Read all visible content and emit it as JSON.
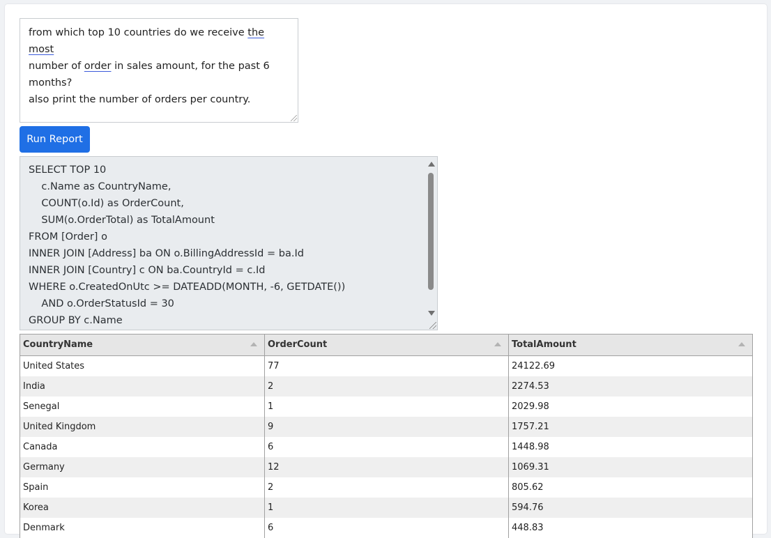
{
  "prompt": {
    "line1_a": "from which top 10 countries do we receive ",
    "line1_u": "the most",
    "line2_a": "number of ",
    "line2_u": "order",
    "line2_b": " in sales amount, for the past 6 months?",
    "line3": "also print the number of orders per country."
  },
  "run_button_label": "Run Report",
  "sql_lines": [
    "SELECT TOP 10",
    "    c.Name as CountryName,",
    "    COUNT(o.Id) as OrderCount,",
    "    SUM(o.OrderTotal) as TotalAmount",
    "FROM [Order] o",
    "INNER JOIN [Address] ba ON o.BillingAddressId = ba.Id",
    "INNER JOIN [Country] c ON ba.CountryId = c.Id",
    "WHERE o.CreatedOnUtc >= DATEADD(MONTH, -6, GETDATE())",
    "    AND o.OrderStatusId = 30",
    "GROUP BY c.Name"
  ],
  "table": {
    "columns": [
      "CountryName",
      "OrderCount",
      "TotalAmount"
    ],
    "rows": [
      [
        "United States",
        "77",
        "24122.69"
      ],
      [
        "India",
        "2",
        "2274.53"
      ],
      [
        "Senegal",
        "1",
        "2029.98"
      ],
      [
        "United Kingdom",
        "9",
        "1757.21"
      ],
      [
        "Canada",
        "6",
        "1448.98"
      ],
      [
        "Germany",
        "12",
        "1069.31"
      ],
      [
        "Spain",
        "2",
        "805.62"
      ],
      [
        "Korea",
        "1",
        "594.76"
      ],
      [
        "Denmark",
        "6",
        "448.83"
      ]
    ]
  }
}
